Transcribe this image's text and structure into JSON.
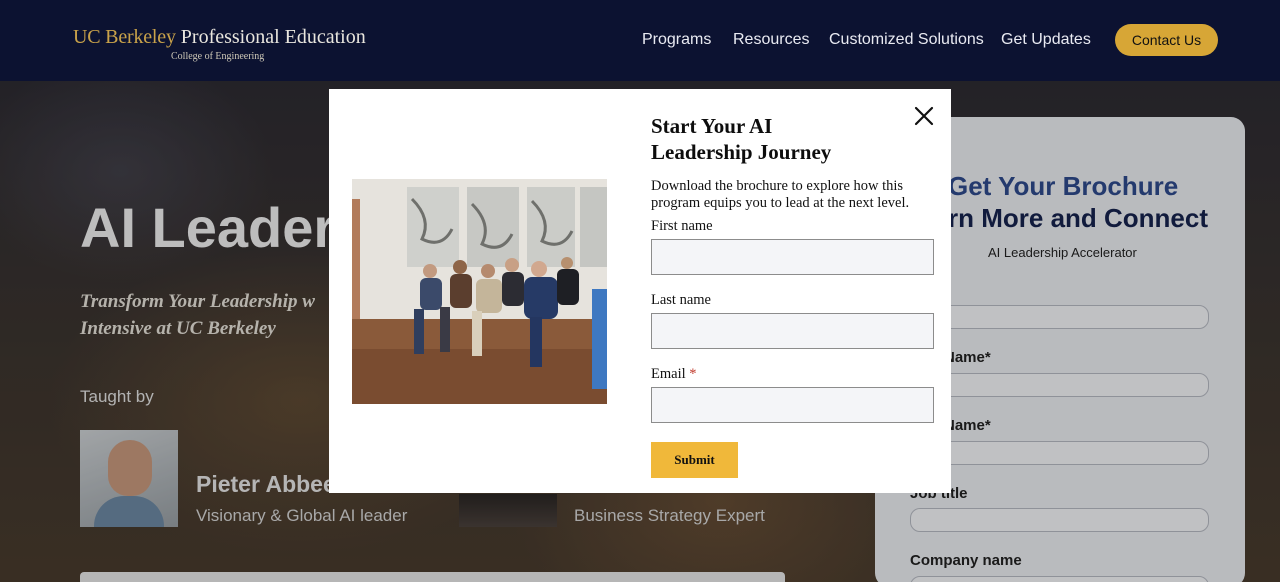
{
  "header": {
    "logo_brand": "UC Berkeley",
    "logo_name": " Professional Education",
    "logo_sub": "College of Engineering",
    "nav": [
      "Programs",
      "Resources",
      "Customized Solutions",
      "Get Updates"
    ],
    "contact_label": "Contact Us",
    "accent_color": "#d7a636"
  },
  "hero": {
    "title": "AI Leaders",
    "subtitle": "Transform Your Leadership w Intensive at UC Berkeley",
    "taught_by": "Taught by",
    "instructors": [
      {
        "name": "Pieter Abbee",
        "role": "Visionary & Global AI leader"
      },
      {
        "name": "",
        "role": "Business Strategy Expert"
      }
    ]
  },
  "panel": {
    "heading1": "Get Your Brochure",
    "heading2": "rn More and Connect",
    "program": "AI Leadership Accelerator",
    "fields": [
      "*",
      "Name*",
      "Name*",
      "Job title",
      "Company name"
    ]
  },
  "modal": {
    "title": "Start Your AI Leadership Journey",
    "description": "Download the brochure to explore how this program equips you to lead at the next level.",
    "fields": [
      {
        "label": "First name",
        "required": ""
      },
      {
        "label": "Last name",
        "required": ""
      },
      {
        "label": "Email",
        "required": "*"
      }
    ],
    "submit_label": "Submit",
    "close_icon": "close-icon",
    "button_color": "#f0b83a"
  }
}
